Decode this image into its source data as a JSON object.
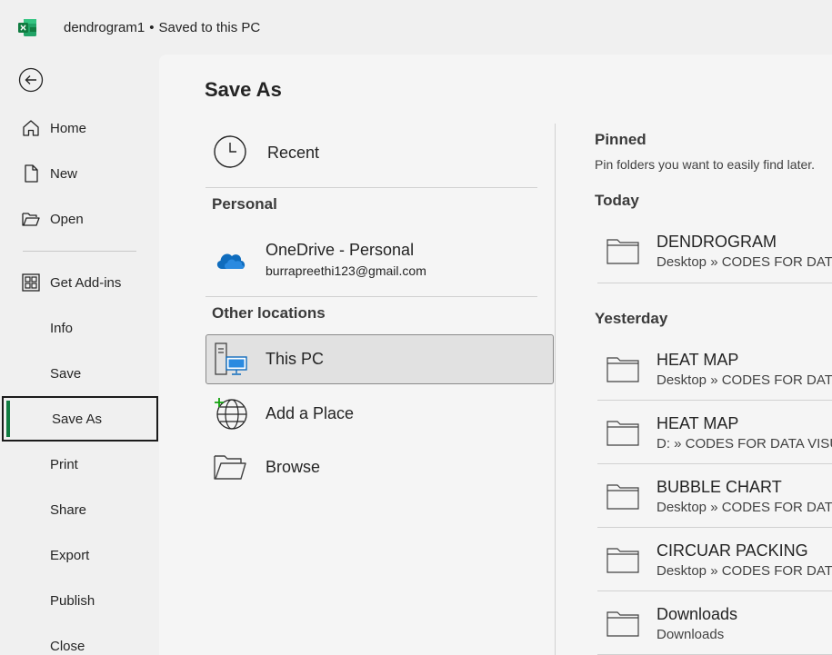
{
  "titlebar": {
    "app_icon": "excel-icon",
    "filename": "dendrogram1",
    "separator": "•",
    "status": "Saved to this PC"
  },
  "nav": {
    "back_icon": "back-arrow-icon",
    "items": [
      {
        "label": "Home",
        "icon": "home-icon"
      },
      {
        "label": "New",
        "icon": "new-document-icon"
      },
      {
        "label": "Open",
        "icon": "open-folder-icon"
      },
      {
        "label": "Get Add-ins",
        "icon": "add-ins-grid-icon"
      },
      {
        "label": "Info"
      },
      {
        "label": "Save"
      },
      {
        "label": "Save As",
        "selected": true
      },
      {
        "label": "Print"
      },
      {
        "label": "Share"
      },
      {
        "label": "Export"
      },
      {
        "label": "Publish"
      },
      {
        "label": "Close"
      }
    ],
    "accent_color": "#107c41"
  },
  "main": {
    "title": "Save As",
    "recent": {
      "label": "Recent",
      "icon": "clock-icon"
    },
    "personal_heading": "Personal",
    "onedrive": {
      "title": "OneDrive - Personal",
      "email": "burrapreethi123@gmail.com",
      "icon": "onedrive-cloud-icon"
    },
    "other_heading": "Other locations",
    "this_pc": {
      "label": "This PC",
      "icon": "this-pc-icon"
    },
    "add_place": {
      "label": "Add a Place",
      "icon": "add-place-globe-icon"
    },
    "browse": {
      "label": "Browse",
      "icon": "browse-folder-icon"
    }
  },
  "folders": {
    "pinned_heading": "Pinned",
    "pinned_hint": "Pin folders you want to easily find later.",
    "today_heading": "Today",
    "yesterday_heading": "Yesterday",
    "today": [
      {
        "name": "DENDROGRAM",
        "path": "Desktop » CODES FOR DATA"
      }
    ],
    "yesterday": [
      {
        "name": "HEAT MAP",
        "path": "Desktop » CODES FOR DATA"
      },
      {
        "name": "HEAT MAP",
        "path": "D: » CODES FOR DATA VISUA"
      },
      {
        "name": "BUBBLE CHART",
        "path": "Desktop » CODES FOR DATA"
      },
      {
        "name": "CIRCUAR PACKING",
        "path": "Desktop » CODES FOR DATA"
      },
      {
        "name": "Downloads",
        "path": "Downloads"
      }
    ]
  }
}
